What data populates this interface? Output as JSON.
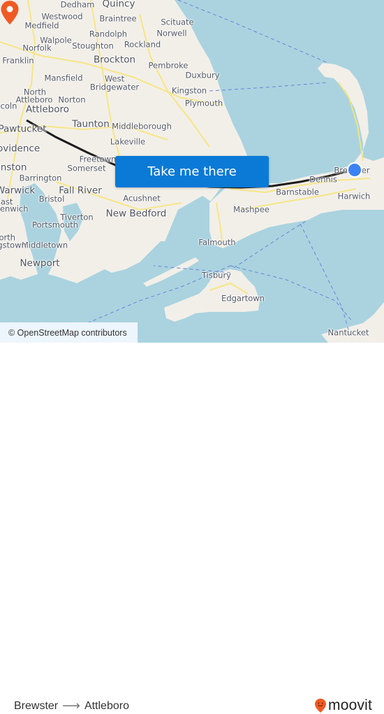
{
  "map": {
    "colors": {
      "water": "#aad3df",
      "land": "#f2efe9",
      "roads": "#f7e67a",
      "route": "#1c1c1c",
      "origin": "#3b82f6",
      "destination_pin": "#f05a22",
      "cta_background": "#0a7ad6",
      "ferry_lines": "#6a84d8"
    },
    "places": [
      {
        "name": "Dedham"
      },
      {
        "name": "Quincy"
      },
      {
        "name": "Westwood"
      },
      {
        "name": "Braintree"
      },
      {
        "name": "Medfield"
      },
      {
        "name": "Randolph"
      },
      {
        "name": "Scituate"
      },
      {
        "name": "Walpole"
      },
      {
        "name": "Norwell"
      },
      {
        "name": "Norfolk"
      },
      {
        "name": "Stoughton"
      },
      {
        "name": "Rockland"
      },
      {
        "name": "Franklin"
      },
      {
        "name": "Brockton"
      },
      {
        "name": "Pembroke"
      },
      {
        "name": "Duxbury"
      },
      {
        "name": "Mansfield"
      },
      {
        "name": "West"
      },
      {
        "name": "Bridgewater"
      },
      {
        "name": "Kingston"
      },
      {
        "name": "North"
      },
      {
        "name": "Attleboro"
      },
      {
        "name": "Norton"
      },
      {
        "name": "Plymouth"
      },
      {
        "name": "Attleboro"
      },
      {
        "name": "Pawtucket"
      },
      {
        "name": "Taunton"
      },
      {
        "name": "Middleborough"
      },
      {
        "name": "Lakeville"
      },
      {
        "name": "Providence"
      },
      {
        "name": "Freetown"
      },
      {
        "name": "Cranston"
      },
      {
        "name": "Somerset"
      },
      {
        "name": "Barrington"
      },
      {
        "name": "Warwick"
      },
      {
        "name": "Fall River"
      },
      {
        "name": "Bristol"
      },
      {
        "name": "Acushnet"
      },
      {
        "name": "East"
      },
      {
        "name": "Greenwich"
      },
      {
        "name": "New Bedford"
      },
      {
        "name": "Tiverton"
      },
      {
        "name": "Portsmouth"
      },
      {
        "name": "Middletown"
      },
      {
        "name": "North"
      },
      {
        "name": "Kingstown"
      },
      {
        "name": "Newport"
      },
      {
        "name": "Dennis"
      },
      {
        "name": "Brewster"
      },
      {
        "name": "Barnstable"
      },
      {
        "name": "Harwich"
      },
      {
        "name": "Mashpee"
      },
      {
        "name": "Falmouth"
      },
      {
        "name": "Tisbury"
      },
      {
        "name": "Edgartown"
      },
      {
        "name": "Nantucket"
      },
      {
        "name": "Lincoln"
      }
    ],
    "origin_name": "Brewster",
    "destination_name": "Attleboro",
    "cta_label": "Take me there",
    "attribution": "© OpenStreetMap contributors"
  },
  "footer": {
    "from": "Brewster",
    "arrow": "⟶",
    "to": "Attleboro",
    "brand": "moovit"
  }
}
